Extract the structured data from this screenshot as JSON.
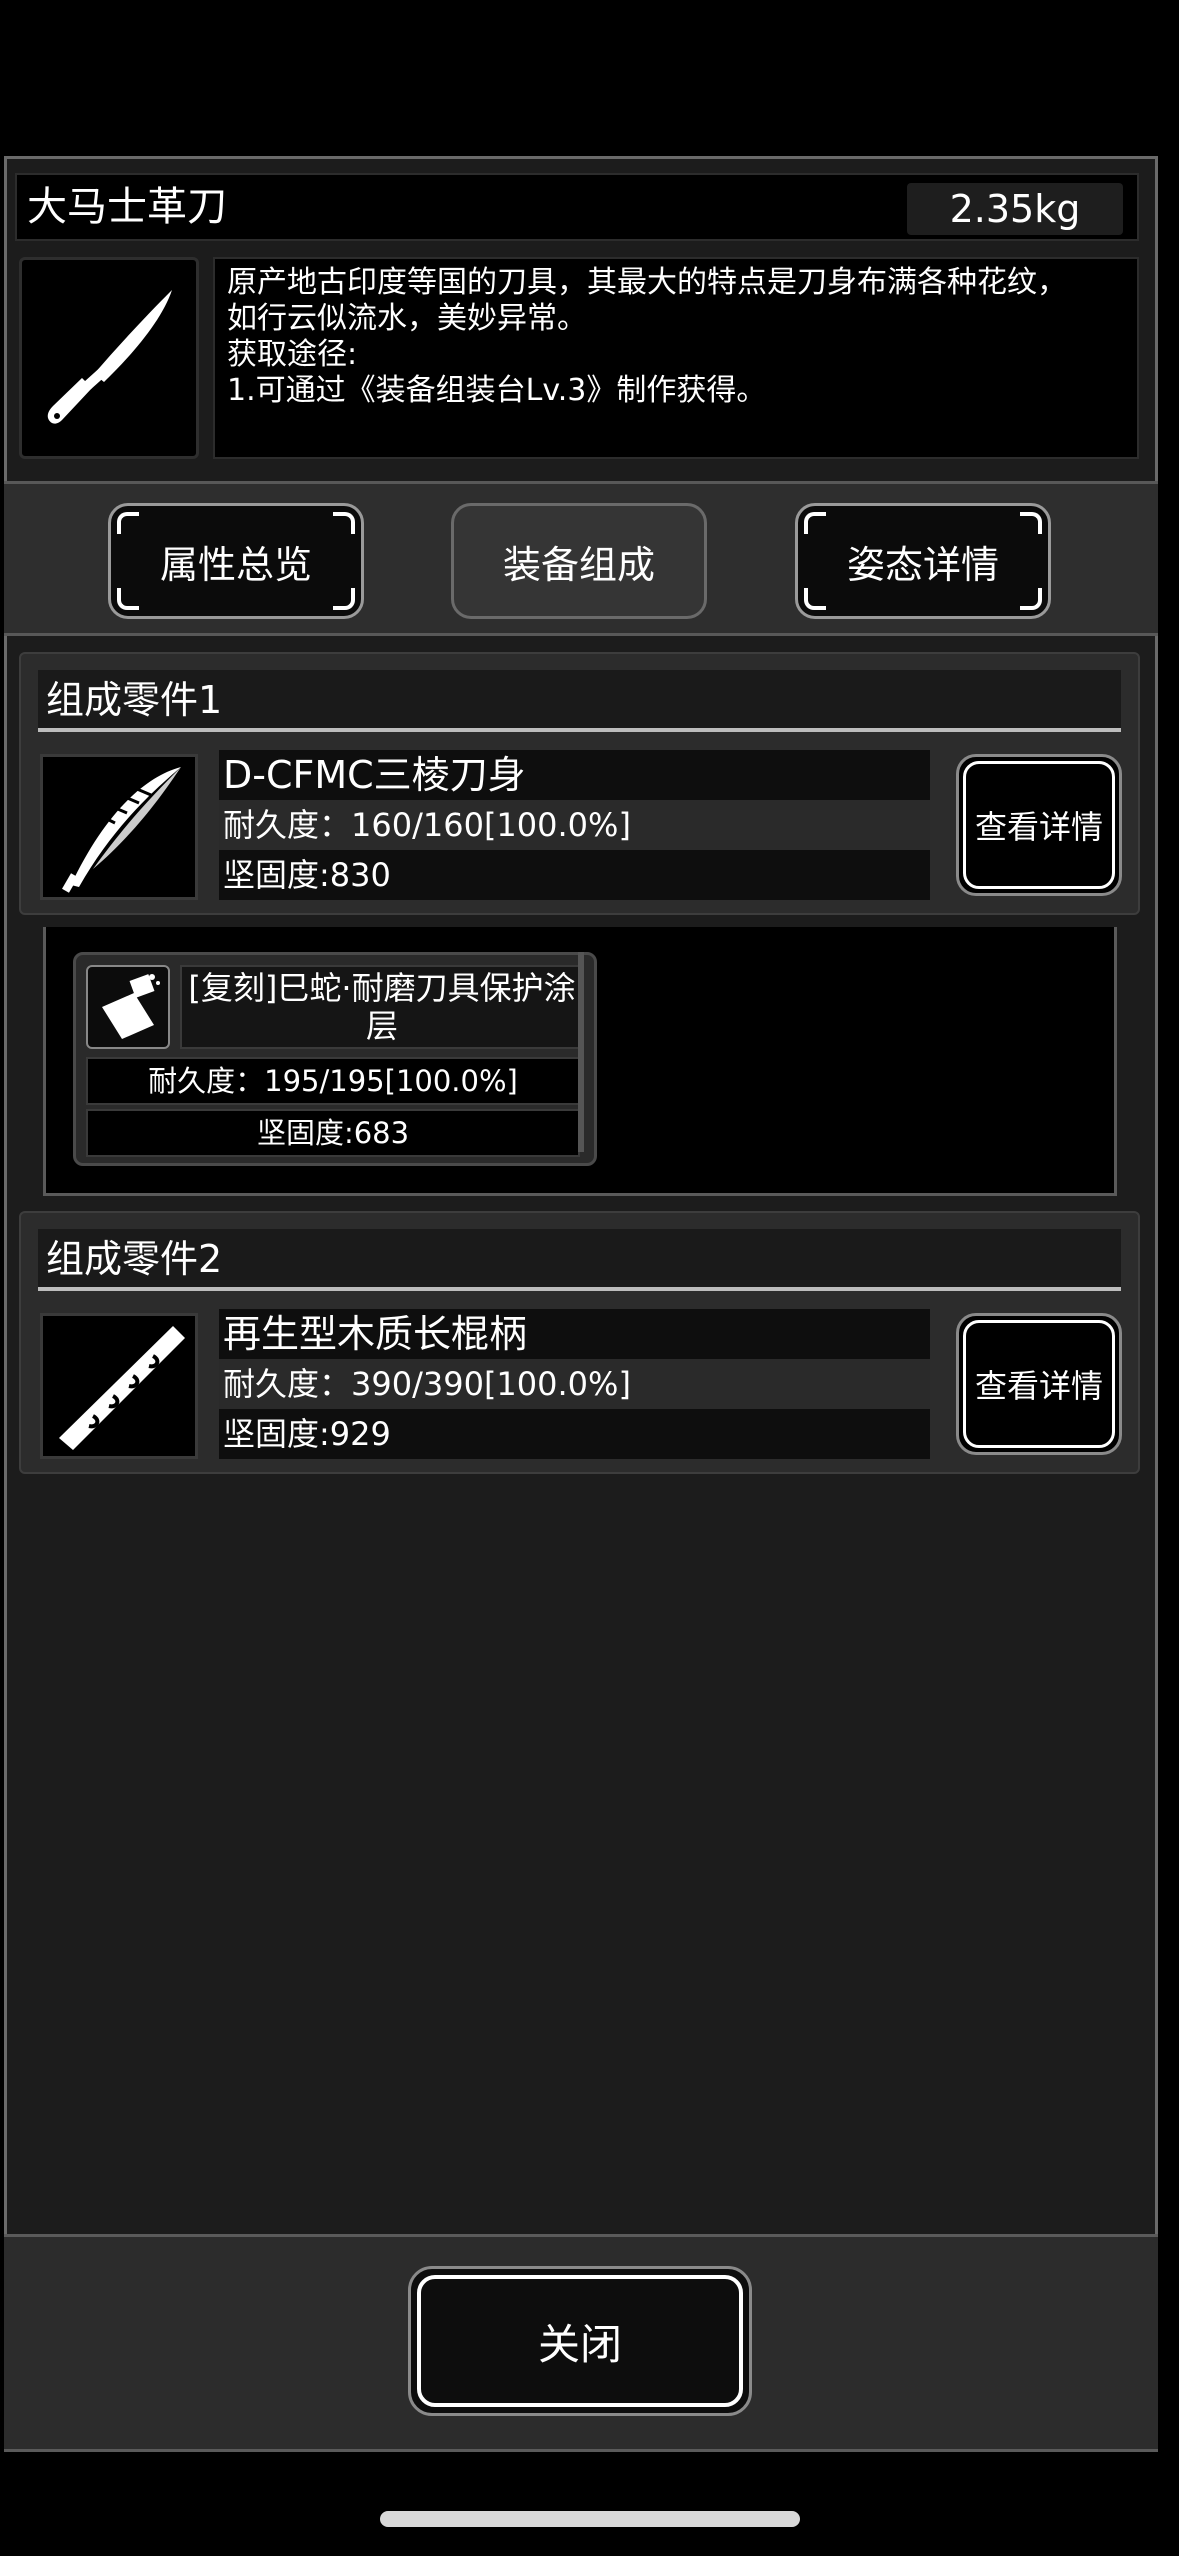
{
  "item": {
    "name": "大马士革刀",
    "weight": "2.35kg",
    "icon": "knife-icon",
    "description": [
      "原产地古印度等国的刀具，其最大的特点是刀身布满各种花纹，",
      "如行云似流水，美妙异常。",
      "获取途径:",
      "1.可通过《装备组装台Lv.3》制作获得。"
    ]
  },
  "tabs": [
    {
      "label": "属性总览",
      "active": false
    },
    {
      "label": "装备组成",
      "active": true
    },
    {
      "label": "姿态详情",
      "active": false
    }
  ],
  "parts": [
    {
      "header": "组成零件1",
      "name": "D-CFMC三棱刀身",
      "durability": "耐久度：160/160[100.0%]",
      "hardness": "坚固度:830",
      "icon": "feather-blade-icon",
      "detail_label": "查看详情",
      "sub_components": [
        {
          "name": "[复刻]巳蛇·耐磨刀具保护涂层",
          "durability": "耐久度：195/195[100.0%]",
          "hardness": "坚固度:683",
          "icon": "spray-can-icon"
        }
      ]
    },
    {
      "header": "组成零件2",
      "name": "再生型木质长棍柄",
      "durability": "耐久度：390/390[100.0%]",
      "hardness": "坚固度:929",
      "icon": "wooden-stick-icon",
      "detail_label": "查看详情"
    }
  ],
  "footer": {
    "close_label": "关闭"
  }
}
